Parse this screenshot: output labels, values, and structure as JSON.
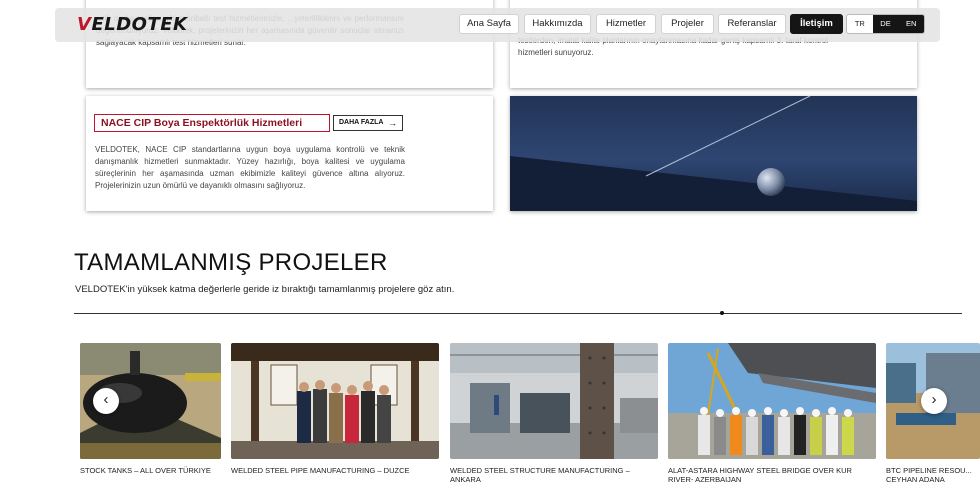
{
  "header": {
    "logo_text": "VELDOTEK",
    "nav_items": [
      "Ana Sayfa",
      "Hakkımızda",
      "Hizmetler",
      "Projeler",
      "Referanslar",
      "İletişim"
    ],
    "active_item": "İletişim",
    "languages": [
      "TR",
      "DE",
      "EN"
    ]
  },
  "services": {
    "card1_text": "...tik darbe testleri gibi tahribatlı test hizmetlerimizle, ...yeterliliklerini ve performansını değerlendiriyoruz. Veldotek, projelerinizin her aşamasında güvenilir sonuçlar almanızı sağlayacak kapsamlı test hizmetleri sunar.",
    "card2_text": "testlerden, imalat kalite planlarının onaylanmasına kadar geniş kapsamlı 3. taraf kontrol hizmetleri sunuyoruz.",
    "card3_title": "NACE CIP Boya Enspektörlük Hizmetleri",
    "card3_more": "DAHA FAZLA",
    "card3_text": "VELDOTEK, NACE CIP standartlarına uygun boya uygulama kontrolü ve teknik danışmanlık hizmetleri sunmaktadır. Yüzey hazırlığı, boya kalitesi ve uygulama süreçlerinin her aşamasında uzman ekibimizle kaliteyi güvence altına alıyoruz. Projelerinizin uzun ömürlü ve dayanıklı olmasını sağlıyoruz."
  },
  "projects_section": {
    "title": "TAMAMLANMIŞ PROJELER",
    "subtitle": "VELDOTEK'in yüksek katma değerlerle geride iz bıraktığı tamamlanmış projelere göz atın.",
    "items": [
      {
        "caption": "STOCK TANKS – ALL OVER TÜRKIYE"
      },
      {
        "caption": "WELDED STEEL PIPE MANUFACTURING – DUZCE"
      },
      {
        "caption": "WELDED STEEL STRUCTURE MANUFACTURING – ANKARA"
      },
      {
        "caption": "ALAT-ASTARA HIGHWAY STEEL BRIDGE OVER KUR RIVER- AZERBAIJAN"
      },
      {
        "caption": "BTC PIPELINE RESOU... CEYHAN ADANA"
      }
    ],
    "prev_icon": "chevron-left-icon",
    "next_icon": "chevron-right-icon"
  },
  "colors": {
    "brand_red": "#c0162c",
    "dark": "#151515"
  }
}
